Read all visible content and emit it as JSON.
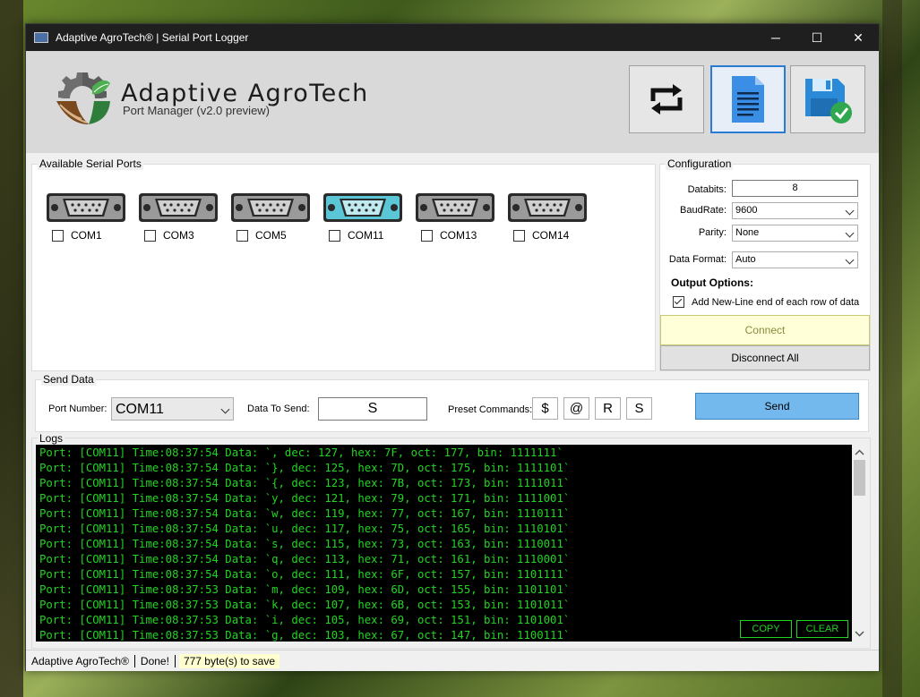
{
  "window": {
    "title": "Adaptive AgroTech® | Serial Port Logger",
    "minimize": "─",
    "maximize": "☐",
    "close": "✕"
  },
  "header": {
    "brand": "Adaptive AgroTech",
    "subtitle": "Port Manager (v2.0 preview)",
    "tools": [
      {
        "name": "refresh",
        "icon": "refresh-icon"
      },
      {
        "name": "document",
        "icon": "document-icon"
      },
      {
        "name": "save",
        "icon": "save-icon"
      }
    ]
  },
  "ports": {
    "title": "Available Serial Ports",
    "items": [
      {
        "label": "COM1",
        "checked": false,
        "active": false
      },
      {
        "label": "COM3",
        "checked": false,
        "active": false
      },
      {
        "label": "COM5",
        "checked": false,
        "active": false
      },
      {
        "label": "COM11",
        "checked": false,
        "active": true
      },
      {
        "label": "COM13",
        "checked": false,
        "active": false
      },
      {
        "label": "COM14",
        "checked": false,
        "active": false
      }
    ]
  },
  "config": {
    "title": "Configuration",
    "databits_label": "Databits:",
    "databits_value": "8",
    "baudrate_label": "BaudRate:",
    "baudrate_value": "9600",
    "parity_label": "Parity:",
    "parity_value": "None",
    "format_label": "Data Format:",
    "format_value": "Auto",
    "output_title": "Output Options:",
    "newline_label": "Add New-Line end of each row of data",
    "newline_checked": true,
    "connect_label": "Connect",
    "disconnect_label": "Disconnect All"
  },
  "send": {
    "title": "Send Data",
    "port_label": "Port Number:",
    "port_value": "COM11",
    "data_label": "Data To Send:",
    "data_value": "S",
    "preset_label": "Preset Commands:",
    "presets": [
      "$",
      "@",
      "R",
      "S"
    ],
    "send_label": "Send"
  },
  "logs": {
    "title": "Logs",
    "lines": [
      "Port: [COM11] Time:08:37:54 Data: `, dec: 127, hex: 7F, oct: 177, bin: 1111111`",
      "Port: [COM11] Time:08:37:54 Data: `}, dec: 125, hex: 7D, oct: 175, bin: 1111101`",
      "Port: [COM11] Time:08:37:54 Data: `{, dec: 123, hex: 7B, oct: 173, bin: 1111011`",
      "Port: [COM11] Time:08:37:54 Data: `y, dec: 121, hex: 79, oct: 171, bin: 1111001`",
      "Port: [COM11] Time:08:37:54 Data: `w, dec: 119, hex: 77, oct: 167, bin: 1110111`",
      "Port: [COM11] Time:08:37:54 Data: `u, dec: 117, hex: 75, oct: 165, bin: 1110101`",
      "Port: [COM11] Time:08:37:54 Data: `s, dec: 115, hex: 73, oct: 163, bin: 1110011`",
      "Port: [COM11] Time:08:37:54 Data: `q, dec: 113, hex: 71, oct: 161, bin: 1110001`",
      "Port: [COM11] Time:08:37:54 Data: `o, dec: 111, hex: 6F, oct: 157, bin: 1101111`",
      "Port: [COM11] Time:08:37:53 Data: `m, dec: 109, hex: 6D, oct: 155, bin: 1101101`",
      "Port: [COM11] Time:08:37:53 Data: `k, dec: 107, hex: 6B, oct: 153, bin: 1101011`",
      "Port: [COM11] Time:08:37:53 Data: `i, dec: 105, hex: 69, oct: 151, bin: 1101001`",
      "Port: [COM11] Time:08:37:53 Data: `g, dec: 103, hex: 67, oct: 147, bin: 1100111`"
    ],
    "copy_label": "COPY",
    "clear_label": "CLEAR"
  },
  "status": {
    "app": "Adaptive AgroTech®",
    "state": "Done!",
    "bytes": "777 byte(s) to save"
  },
  "colors": {
    "log_text": "#22d422",
    "log_bg": "#000000",
    "send_button": "#74b9ee",
    "connect_button": "#ffffd8",
    "active_port": "#5bc6d6"
  }
}
